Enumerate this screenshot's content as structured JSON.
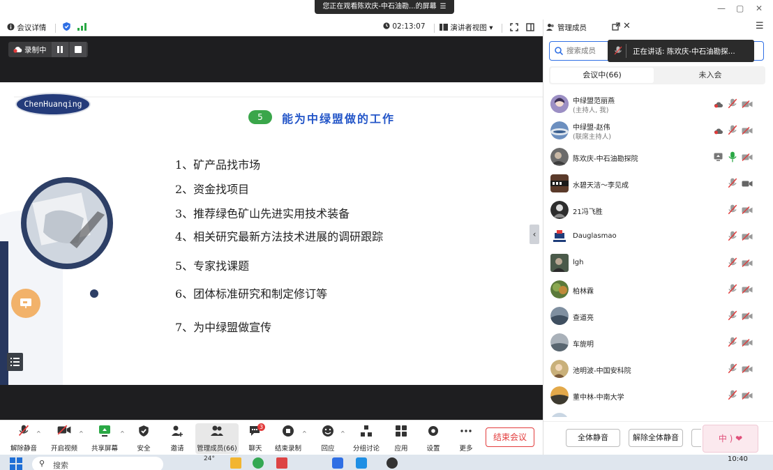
{
  "window": {
    "watching_banner": "您正在观看陈欢庆-中石油勘...的屏幕",
    "min_glyph": "—",
    "restore_glyph": "▢",
    "close_glyph": "✕"
  },
  "meeting_bar": {
    "details_label": "会议详情",
    "timer": "02:13:07",
    "view_mode": "演讲者视图",
    "caret": "▾"
  },
  "recording": {
    "label": "录制中"
  },
  "slide": {
    "badge": "ChenHuanqing",
    "section_number": "5",
    "title": "能为中绿盟做的工作",
    "items": [
      "1、矿产品找市场",
      "2、资金找项目",
      "3、推荐绿色矿山先进实用技术装备",
      "4、相关研究最新方法技术进展的调研跟踪",
      "5、专家找课题",
      "6、团体标准研究和制定修订等",
      "7、为中绿盟做宣传"
    ]
  },
  "panel": {
    "title": "管理成员",
    "search_placeholder": "搜索成员",
    "speaking_label": "正在讲话: 陈欢庆-中石油勘探...",
    "tab_in": "会议中(66)",
    "tab_out": "未入会",
    "members": [
      {
        "name": "中绿盟范丽燕",
        "role": "(主持人, 我)"
      },
      {
        "name": "中绿盟-赵伟",
        "role": "(联席主持人)"
      },
      {
        "name": "陈欢庆-中石油勘探院",
        "role": ""
      },
      {
        "name": "水碧天洁～李见成",
        "role": ""
      },
      {
        "name": "21冯飞胜",
        "role": ""
      },
      {
        "name": "Dauglasmao",
        "role": ""
      },
      {
        "name": "lgh",
        "role": ""
      },
      {
        "name": "柏林霖",
        "role": ""
      },
      {
        "name": "查道亮",
        "role": ""
      },
      {
        "name": "车旎明",
        "role": ""
      },
      {
        "name": "池明波-中国安科院",
        "role": ""
      },
      {
        "name": "董中林-中南大学",
        "role": ""
      }
    ],
    "mute_all": "全体静音",
    "unmute_all": "解除全体静音",
    "overlay_text": "中 ) ❤"
  },
  "toolbar": {
    "items": [
      {
        "label": "解除静音"
      },
      {
        "label": "开启视频"
      },
      {
        "label": "共享屏幕"
      },
      {
        "label": "安全"
      },
      {
        "label": "邀请"
      },
      {
        "label": "管理成员(66)"
      },
      {
        "label": "聊天",
        "badge": "3"
      },
      {
        "label": "结束录制"
      },
      {
        "label": "回应"
      },
      {
        "label": "分组讨论"
      },
      {
        "label": "应用"
      },
      {
        "label": "设置"
      },
      {
        "label": "更多"
      }
    ],
    "end_meeting": "结束会议"
  },
  "taskbar": {
    "search": "搜索",
    "weather": "24°",
    "clock": "10:40"
  },
  "colors": {
    "accent_blue": "#2f6fe4",
    "end_red": "#e23b3b",
    "slide_green": "#3aa64a",
    "slide_title_blue": "#2456c8",
    "badge_navy": "#243b7a"
  }
}
